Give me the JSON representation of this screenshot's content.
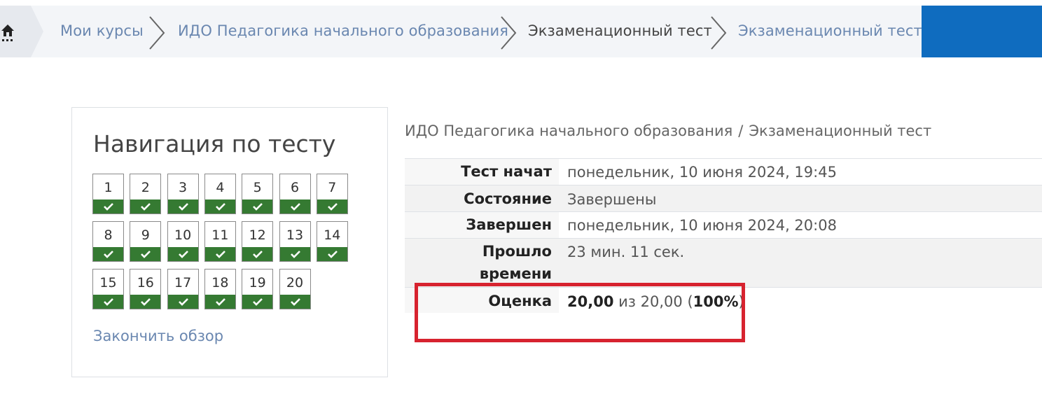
{
  "breadcrumb": {
    "items": [
      {
        "label": "Мои курсы"
      },
      {
        "label": "ИДО Педагогика начального образования"
      },
      {
        "label": "Экзаменационный тест"
      },
      {
        "label": "Экзаменационный тест"
      }
    ],
    "home_icon": "home-icon"
  },
  "navigation": {
    "title": "Навигация по тесту",
    "questions": [
      "1",
      "2",
      "3",
      "4",
      "5",
      "6",
      "7",
      "8",
      "9",
      "10",
      "11",
      "12",
      "13",
      "14",
      "15",
      "16",
      "17",
      "18",
      "19",
      "20"
    ],
    "question_status_icon": "check-icon",
    "finish_label": "Закончить обзор"
  },
  "summary": {
    "breadcrumb": {
      "course": "ИДО Педагогика начального образования",
      "separator": "/",
      "test": "Экзаменационный тест"
    },
    "rows": {
      "started": {
        "label": "Тест начат",
        "value": "понедельник, 10 июня 2024, 19:45"
      },
      "state": {
        "label": "Состояние",
        "value": "Завершены"
      },
      "completed": {
        "label": "Завершен",
        "value": "понедельник, 10 июня 2024, 20:08"
      },
      "elapsed": {
        "label_line1": "Прошло",
        "label_line2": "времени",
        "value": "23 мин. 11 сек."
      },
      "grade": {
        "label": "Оценка",
        "score": "20,00",
        "of_word": "из",
        "max": "20,00",
        "percent": "100%"
      }
    }
  },
  "colors": {
    "accent": "#0f6cbf",
    "answered": "#357a32",
    "highlight": "#d7232f",
    "link": "#6a87b0"
  }
}
